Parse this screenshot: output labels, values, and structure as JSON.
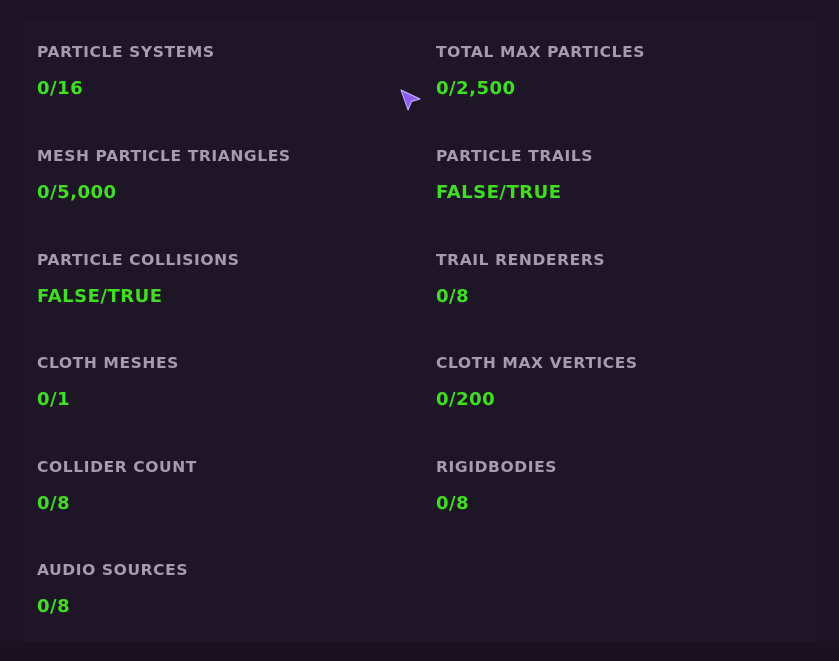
{
  "stats": {
    "particle_systems": {
      "label": "PARTICLE SYSTEMS",
      "value": "0/16"
    },
    "total_max_particles": {
      "label": "TOTAL MAX PARTICLES",
      "value": "0/2,500"
    },
    "mesh_particle_triangles": {
      "label": "MESH PARTICLE TRIANGLES",
      "value": "0/5,000"
    },
    "particle_trails": {
      "label": "PARTICLE TRAILS",
      "value": "FALSE/TRUE"
    },
    "particle_collisions": {
      "label": "PARTICLE COLLISIONS",
      "value": "FALSE/TRUE"
    },
    "trail_renderers": {
      "label": "TRAIL RENDERERS",
      "value": "0/8"
    },
    "cloth_meshes": {
      "label": "CLOTH MESHES",
      "value": "0/1"
    },
    "cloth_max_vertices": {
      "label": "CLOTH MAX VERTICES",
      "value": "0/200"
    },
    "collider_count": {
      "label": "COLLIDER COUNT",
      "value": "0/8"
    },
    "rigidbodies": {
      "label": "RIGIDBODIES",
      "value": "0/8"
    },
    "audio_sources": {
      "label": "AUDIO SOURCES",
      "value": "0/8"
    }
  },
  "colors": {
    "background": "#1c1324",
    "label": "#a59cae",
    "value": "#3ee01e",
    "cursor": "#8a5cf0"
  },
  "cursor": {
    "icon": "pointer-cursor-icon"
  }
}
